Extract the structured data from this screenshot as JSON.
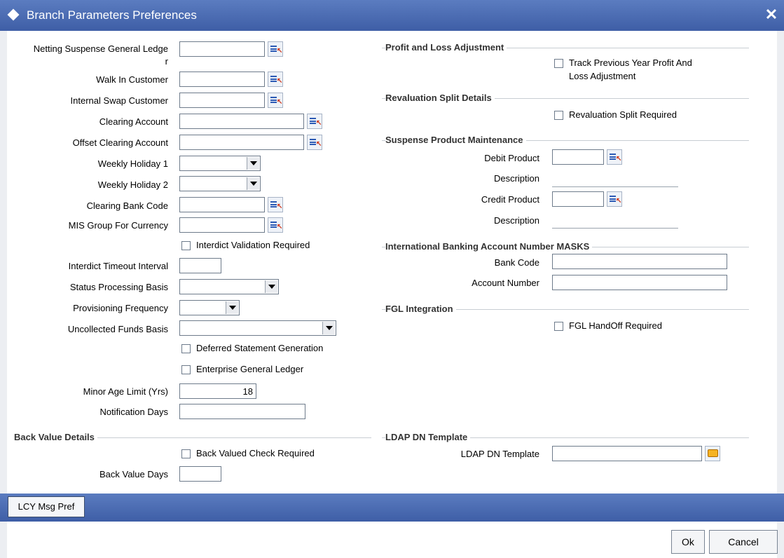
{
  "window": {
    "title": "Branch Parameters Preferences",
    "close_label": "✕"
  },
  "left": {
    "netting_label": "Netting Suspense General Ledge",
    "netting_label_tail": "r",
    "walkin_label": "Walk In Customer",
    "internal_swap_label": "Internal Swap Customer",
    "clearing_account_label": "Clearing Account",
    "offset_clearing_label": "Offset Clearing Account",
    "weekly1_label": "Weekly Holiday 1",
    "weekly2_label": "Weekly Holiday 2",
    "clearing_bank_label": "Clearing Bank Code",
    "mis_group_label": "MIS Group For Currency",
    "interdict_validation_label": "Interdict Validation Required",
    "interdict_timeout_label": "Interdict Timeout Interval",
    "status_processing_label": "Status Processing Basis",
    "provisioning_label": "Provisioning Frequency",
    "uncollected_label": "Uncollected Funds Basis",
    "deferred_stmt_label": "Deferred Statement Generation",
    "enterprise_gl_label": "Enterprise General Ledger",
    "minor_age_label": "Minor Age Limit (Yrs)",
    "minor_age_value": "18",
    "notification_days_label": "Notification Days"
  },
  "back_value": {
    "section_title": "Back Value Details",
    "check_label": "Back Valued Check Required",
    "days_label": "Back Value Days"
  },
  "right": {
    "pl_section": "Profit and Loss Adjustment",
    "pl_check_line1": "Track Previous Year Profit And",
    "pl_check_line2": "Loss Adjustment",
    "reval_section": "Revaluation Split Details",
    "reval_check": "Revaluation Split Required",
    "suspense_section": "Suspense Product Maintenance",
    "debit_product_label": "Debit Product",
    "description_label": "Description",
    "credit_product_label": "Credit Product",
    "iban_section": "International Banking Account Number MASKS",
    "bank_code_label": "Bank Code",
    "account_number_label": "Account Number",
    "fgl_section": "FGL Integration",
    "fgl_check": "FGL HandOff Required",
    "ldap_section": "LDAP DN Template",
    "ldap_label": "LDAP DN Template"
  },
  "bottom": {
    "tab_label": "LCY Msg Pref",
    "ok_label": "Ok",
    "cancel_label": "Cancel"
  }
}
